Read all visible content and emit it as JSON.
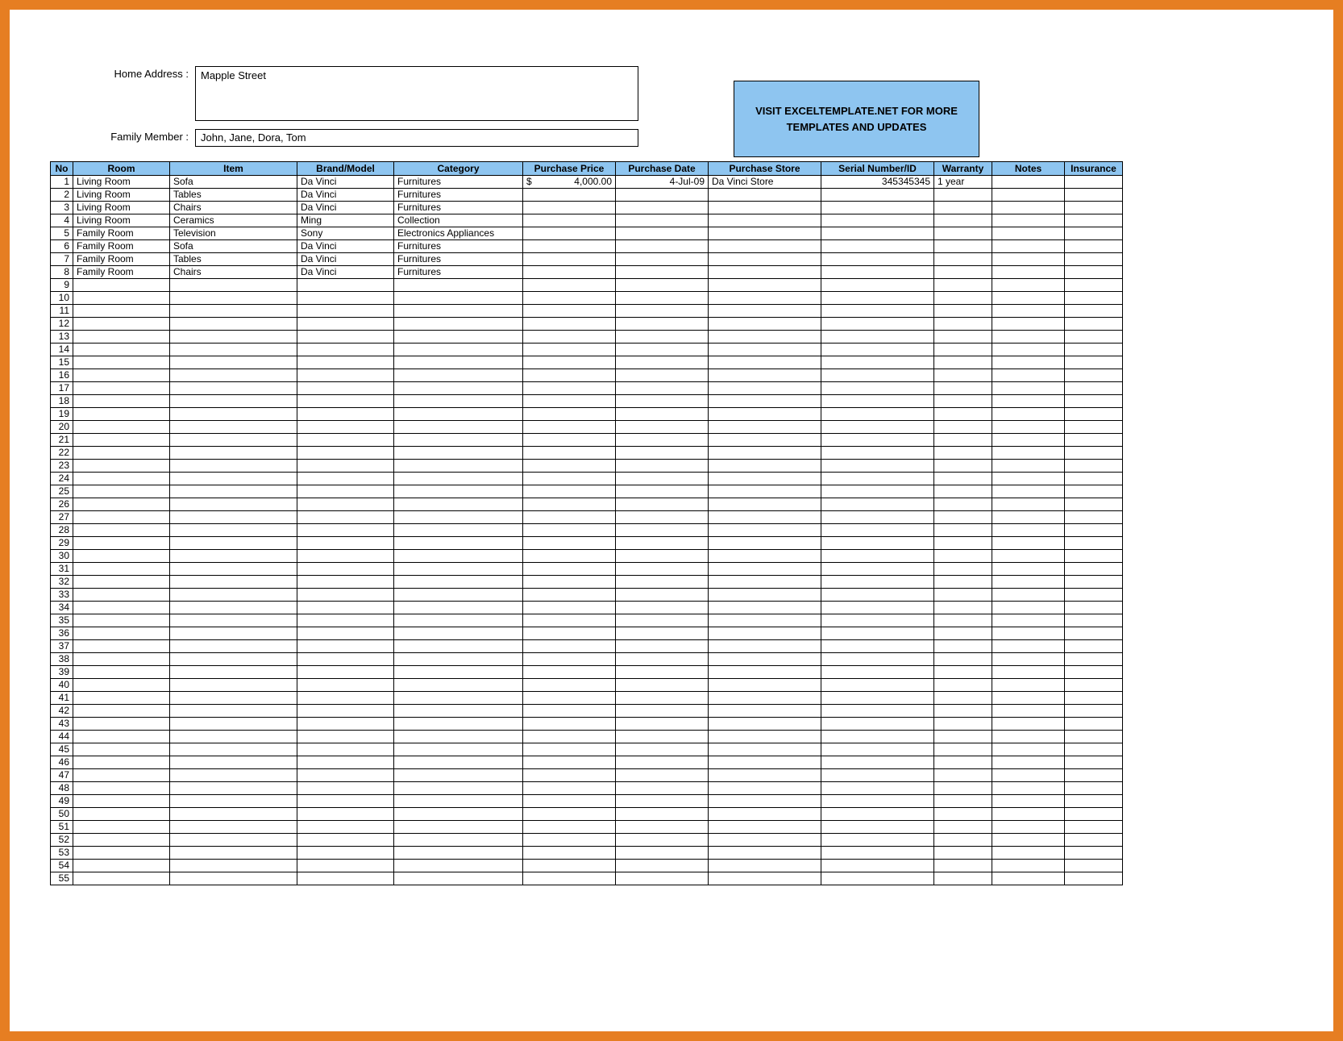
{
  "form": {
    "address_label": "Home Address :",
    "address_value": "Mapple Street",
    "member_label": "Family Member :",
    "member_value": "John, Jane, Dora, Tom"
  },
  "banner": {
    "text": "VISIT EXCELTEMPLATE.NET FOR MORE TEMPLATES AND UPDATES"
  },
  "columns": {
    "no": "No",
    "room": "Room",
    "item": "Item",
    "brand": "Brand/Model",
    "category": "Category",
    "price": "Purchase Price",
    "date": "Purchase Date",
    "store": "Purchase Store",
    "serial": "Serial Number/ID",
    "warranty": "Warranty",
    "notes": "Notes",
    "insurance": "Insurance"
  },
  "total_rows": 55,
  "rows": [
    {
      "no": "1",
      "room": "Living Room",
      "item": "Sofa",
      "brand": "Da Vinci",
      "category": "Furnitures",
      "price_sym": "$",
      "price_val": "4,000.00",
      "date": "4-Jul-09",
      "store": "Da Vinci Store",
      "serial": "345345345",
      "warranty": "1 year",
      "notes": "",
      "insurance": ""
    },
    {
      "no": "2",
      "room": "Living Room",
      "item": "Tables",
      "brand": "Da Vinci",
      "category": "Furnitures",
      "price_sym": "",
      "price_val": "",
      "date": "",
      "store": "",
      "serial": "",
      "warranty": "",
      "notes": "",
      "insurance": ""
    },
    {
      "no": "3",
      "room": "Living Room",
      "item": "Chairs",
      "brand": "Da Vinci",
      "category": "Furnitures",
      "price_sym": "",
      "price_val": "",
      "date": "",
      "store": "",
      "serial": "",
      "warranty": "",
      "notes": "",
      "insurance": ""
    },
    {
      "no": "4",
      "room": "Living Room",
      "item": "Ceramics",
      "brand": "Ming",
      "category": "Collection",
      "price_sym": "",
      "price_val": "",
      "date": "",
      "store": "",
      "serial": "",
      "warranty": "",
      "notes": "",
      "insurance": ""
    },
    {
      "no": "5",
      "room": "Family Room",
      "item": "Television",
      "brand": "Sony",
      "category": "Electronics Appliances",
      "price_sym": "",
      "price_val": "",
      "date": "",
      "store": "",
      "serial": "",
      "warranty": "",
      "notes": "",
      "insurance": ""
    },
    {
      "no": "6",
      "room": "Family Room",
      "item": "Sofa",
      "brand": "Da Vinci",
      "category": "Furnitures",
      "price_sym": "",
      "price_val": "",
      "date": "",
      "store": "",
      "serial": "",
      "warranty": "",
      "notes": "",
      "insurance": ""
    },
    {
      "no": "7",
      "room": "Family Room",
      "item": "Tables",
      "brand": "Da Vinci",
      "category": "Furnitures",
      "price_sym": "",
      "price_val": "",
      "date": "",
      "store": "",
      "serial": "",
      "warranty": "",
      "notes": "",
      "insurance": ""
    },
    {
      "no": "8",
      "room": "Family Room",
      "item": "Chairs",
      "brand": "Da Vinci",
      "category": "Furnitures",
      "price_sym": "",
      "price_val": "",
      "date": "",
      "store": "",
      "serial": "",
      "warranty": "",
      "notes": "",
      "insurance": ""
    }
  ]
}
